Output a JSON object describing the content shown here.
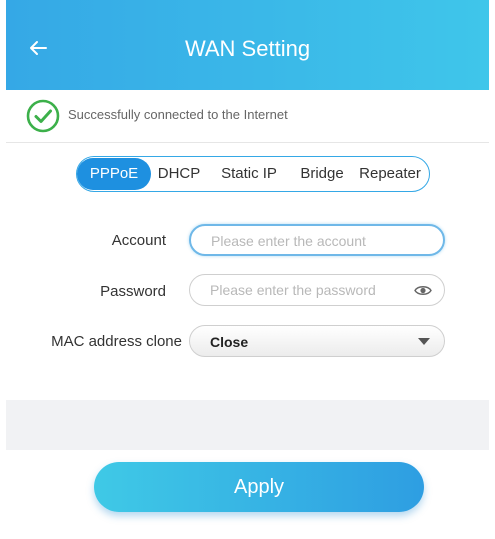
{
  "header": {
    "title": "WAN Setting",
    "back_icon": "arrow-left-icon",
    "gradient_start": "#35a8e6",
    "gradient_end": "#3fc6ea"
  },
  "status": {
    "text": "Successfully connected to the Internet",
    "icon": "check-circle-icon",
    "icon_color": "#3cb04a"
  },
  "tabs": {
    "items": [
      {
        "label": "PPPoE",
        "active": true
      },
      {
        "label": "DHCP",
        "active": false
      },
      {
        "label": "Static IP",
        "active": false
      },
      {
        "label": "Bridge",
        "active": false
      },
      {
        "label": "Repeater",
        "active": false
      }
    ],
    "active_color": "#1e90e0"
  },
  "form": {
    "account": {
      "label": "Account",
      "value": "",
      "placeholder": "Please enter the account"
    },
    "password": {
      "label": "Password",
      "value": "",
      "placeholder": "Please enter the password",
      "toggle_icon": "eye-icon"
    },
    "mac_clone": {
      "label": "MAC address clone",
      "selected": "Close",
      "dropdown_icon": "caret-down-icon"
    }
  },
  "actions": {
    "apply_label": "Apply"
  }
}
